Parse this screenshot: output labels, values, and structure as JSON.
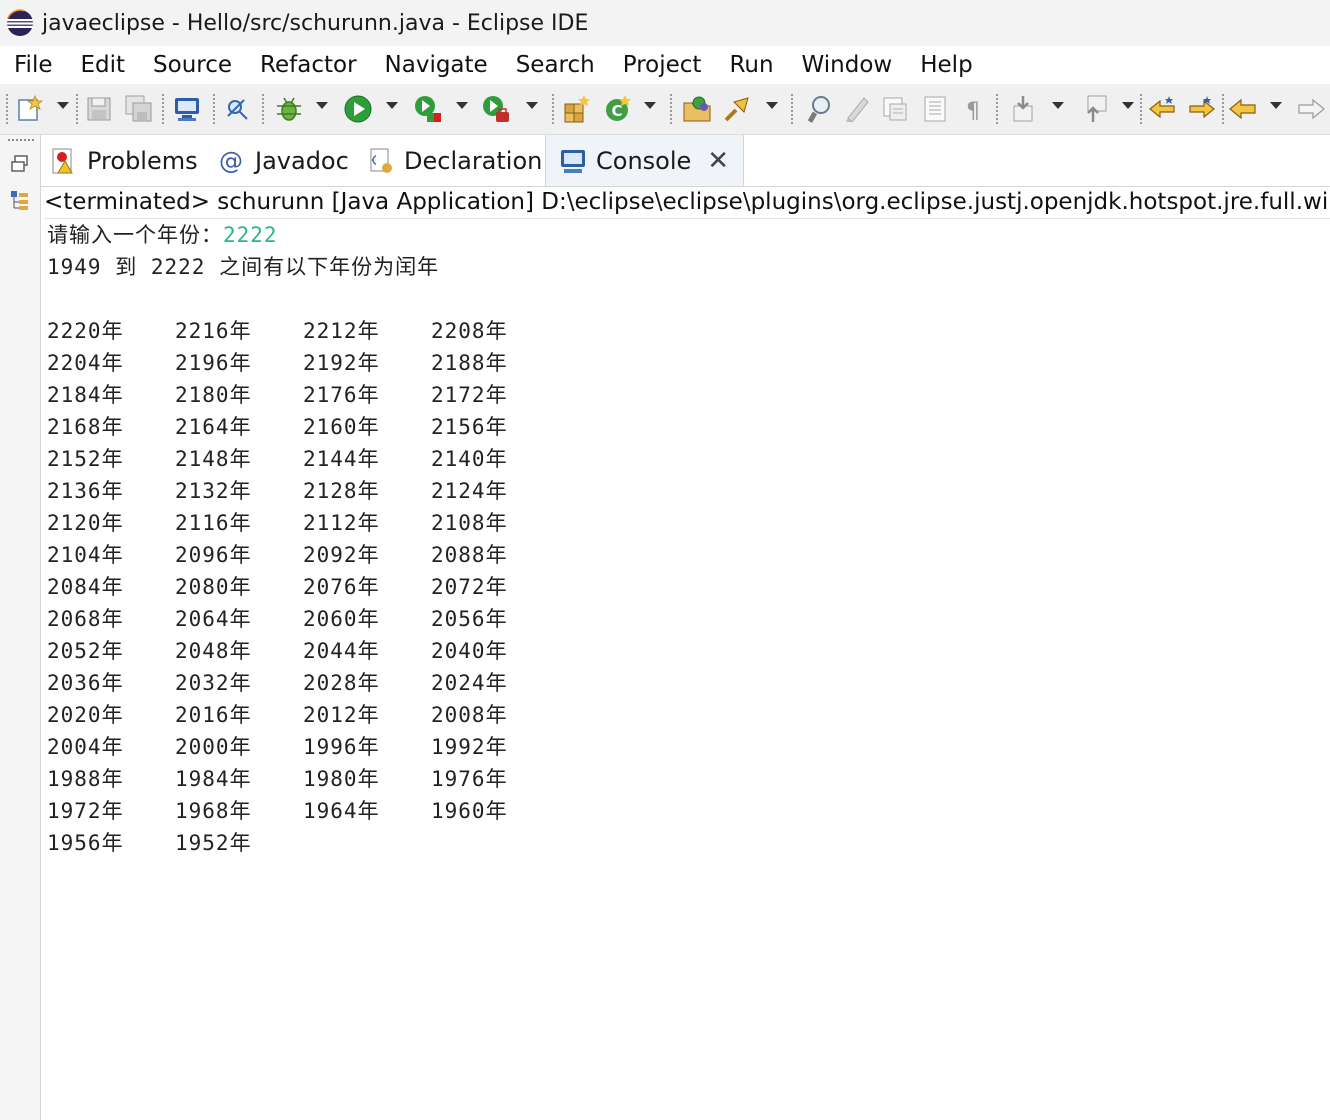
{
  "window": {
    "title": "javaeclipse - Hello/src/schurunn.java - Eclipse IDE",
    "icon": "eclipse-logo"
  },
  "menubar": {
    "items": [
      "File",
      "Edit",
      "Source",
      "Refactor",
      "Navigate",
      "Search",
      "Project",
      "Run",
      "Window",
      "Help"
    ]
  },
  "toolbar": {
    "icons": [
      "new-wizard-icon",
      "save-icon",
      "save-all-icon",
      "open-console-icon",
      "skip-breakpoints-icon",
      "debug-icon",
      "run-icon",
      "coverage-icon",
      "external-tools-icon",
      "new-java-package-icon",
      "new-java-class-icon",
      "open-type-icon",
      "open-task-icon",
      "search-icon",
      "toggle-mark-occurrences-icon",
      "toggle-block-selection-icon",
      "toggle-word-wrap-icon",
      "show-whitespace-icon",
      "next-annotation-icon",
      "previous-annotation-icon",
      "last-edit-location-icon",
      "back-icon",
      "forward-icon"
    ]
  },
  "tabs": [
    {
      "label": "Problems",
      "icon": "problems-icon",
      "active": false
    },
    {
      "label": "Javadoc",
      "icon": "javadoc-icon",
      "active": false
    },
    {
      "label": "Declaration",
      "icon": "declaration-icon",
      "active": false
    },
    {
      "label": "Console",
      "icon": "console-icon",
      "active": true
    }
  ],
  "console": {
    "header": "<terminated> schurunn [Java Application] D:\\eclipse\\eclipse\\plugins\\org.eclipse.justj.openjdk.hotspot.jre.full.win",
    "prompt_label": "请输入一个年份：",
    "prompt_value": "2222",
    "summary_line": "1949 到 2222 之间有以下年份为闰年",
    "accent_input_color": "#2bb58a",
    "year_rows": [
      [
        "2220年",
        "2216年",
        "2212年",
        "2208年"
      ],
      [
        "2204年",
        "2196年",
        "2192年",
        "2188年"
      ],
      [
        "2184年",
        "2180年",
        "2176年",
        "2172年"
      ],
      [
        "2168年",
        "2164年",
        "2160年",
        "2156年"
      ],
      [
        "2152年",
        "2148年",
        "2144年",
        "2140年"
      ],
      [
        "2136年",
        "2132年",
        "2128年",
        "2124年"
      ],
      [
        "2120年",
        "2116年",
        "2112年",
        "2108年"
      ],
      [
        "2104年",
        "2096年",
        "2092年",
        "2088年"
      ],
      [
        "2084年",
        "2080年",
        "2076年",
        "2072年"
      ],
      [
        "2068年",
        "2064年",
        "2060年",
        "2056年"
      ],
      [
        "2052年",
        "2048年",
        "2044年",
        "2040年"
      ],
      [
        "2036年",
        "2032年",
        "2028年",
        "2024年"
      ],
      [
        "2020年",
        "2016年",
        "2012年",
        "2008年"
      ],
      [
        "2004年",
        "2000年",
        "1996年",
        "1992年"
      ],
      [
        "1988年",
        "1984年",
        "1980年",
        "1976年"
      ],
      [
        "1972年",
        "1968年",
        "1964年",
        "1960年"
      ],
      [
        "1956年",
        "1952年"
      ]
    ]
  }
}
